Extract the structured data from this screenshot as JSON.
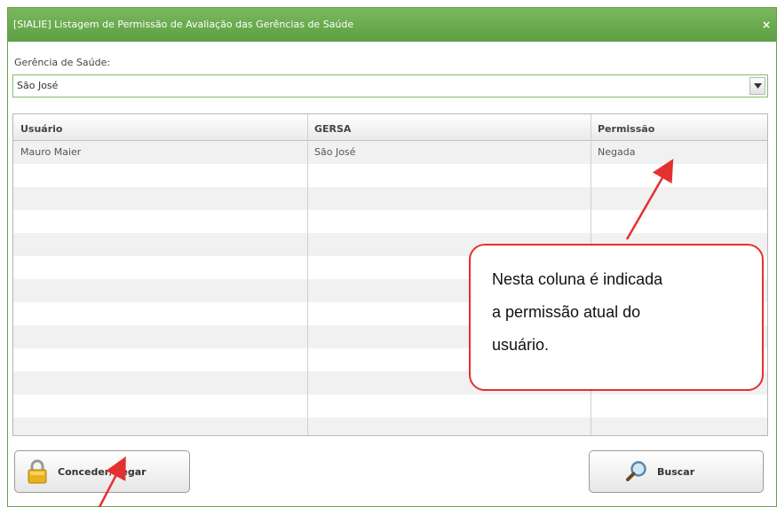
{
  "window": {
    "title": "[SIALIE] Listagem de Permissão de Avaliação das Gerências de Saúde",
    "close_symbol": "×"
  },
  "filter": {
    "label": "Gerência de Saúde:",
    "selected": "São José"
  },
  "table": {
    "headers": [
      "Usuário",
      "GERSA",
      "Permissão"
    ],
    "rows": [
      [
        "Mauro Maier",
        "São José",
        "Negada"
      ],
      [
        "",
        "",
        ""
      ],
      [
        "",
        "",
        ""
      ],
      [
        "",
        "",
        ""
      ],
      [
        "",
        "",
        ""
      ],
      [
        "",
        "",
        ""
      ],
      [
        "",
        "",
        ""
      ],
      [
        "",
        "",
        ""
      ],
      [
        "",
        "",
        ""
      ],
      [
        "",
        "",
        ""
      ],
      [
        "",
        "",
        ""
      ],
      [
        "",
        "",
        ""
      ],
      [
        "",
        "",
        ""
      ]
    ]
  },
  "buttons": {
    "grant_label": "Conceder/Negar",
    "search_label": "Buscar"
  },
  "callout": {
    "lines": [
      "Nesta coluna é indicada",
      "a permissão atual do",
      "usuário."
    ]
  },
  "colors": {
    "titlebar": "#6aa24f",
    "annotation": "#e53030"
  },
  "icons": {
    "lock": "lock-icon",
    "search": "magnifier-icon",
    "dropdown": "chevron-down-icon",
    "close": "close-icon"
  }
}
